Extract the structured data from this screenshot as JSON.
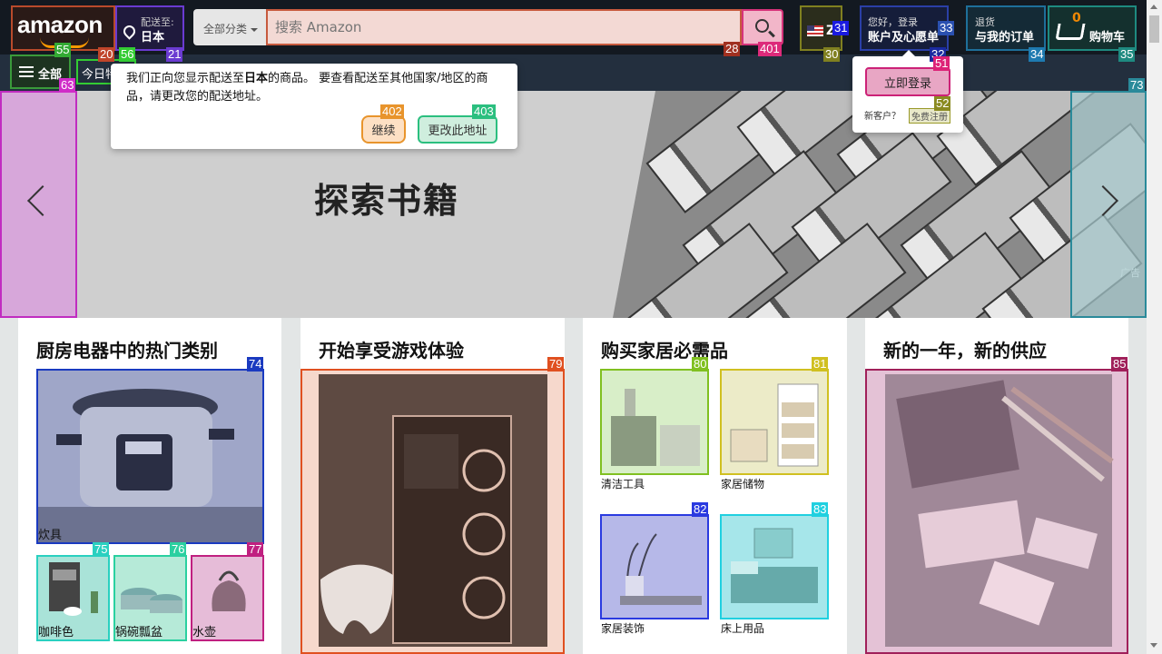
{
  "header": {
    "logo_text": "amazon",
    "deliver_line1": "配送至:",
    "deliver_line2": "日本",
    "search_category": "全部分类",
    "search_placeholder": "搜索 Amazon",
    "language_code": "Z",
    "account_line1": "您好，登录",
    "account_line2": "账户及心愿单",
    "orders_line1": "退货",
    "orders_line2": "与我的订单",
    "cart_count": "0",
    "cart_label": "购物车"
  },
  "subnav": {
    "all_label": "全部",
    "today_deals": "今日特"
  },
  "popup": {
    "message_prefix": "我们正向您显示配送至",
    "message_bold": "日本",
    "message_suffix": "的商品。 要查看配送至其他国家/地区的商品，请更改您的配送地址。",
    "continue_label": "继续",
    "change_label": "更改此地址"
  },
  "signin": {
    "button_label": "立即登录",
    "new_customer": "新客户？",
    "start_here": "免费注册"
  },
  "hero": {
    "title": "探索书籍",
    "ad_label": "广告"
  },
  "cards": [
    {
      "title": "厨房电器中的热门类别",
      "tiles": [
        "炊具",
        "咖啡色",
        "锅碗瓢盆",
        "水壶"
      ]
    },
    {
      "title": "开始享受游戏体验"
    },
    {
      "title": "购买家居必需品",
      "tiles": [
        "清洁工具",
        "家居储物",
        "家居装饰",
        "床上用品"
      ]
    },
    {
      "title": "新的一年，新的供应"
    }
  ],
  "badges": [
    {
      "text": "55",
      "color": "#33aa33"
    },
    {
      "text": "20",
      "color": "#c0452a"
    },
    {
      "text": "56",
      "color": "#33cc33"
    },
    {
      "text": "21",
      "color": "#6a3bd1"
    },
    {
      "text": "28",
      "color": "#a03020"
    },
    {
      "text": "401",
      "color": "#dd2a7a"
    },
    {
      "text": "30",
      "color": "#808020"
    },
    {
      "text": "31",
      "color": "#1a1ae0"
    },
    {
      "text": "33",
      "color": "#2a50b0"
    },
    {
      "text": "32",
      "color": "#1a2aa0"
    },
    {
      "text": "34",
      "color": "#1e7ab0"
    },
    {
      "text": "35",
      "color": "#1e8a80"
    },
    {
      "text": "63",
      "color": "#d02cc8"
    },
    {
      "text": "402",
      "color": "#e8942c"
    },
    {
      "text": "403",
      "color": "#2bbf7f"
    },
    {
      "text": "51",
      "color": "#dd2277"
    },
    {
      "text": "52",
      "color": "#8a8a20"
    },
    {
      "text": "73",
      "color": "#2a8a9a"
    },
    {
      "text": "74",
      "color": "#1a3ac0"
    },
    {
      "text": "75",
      "color": "#2ad0c0"
    },
    {
      "text": "76",
      "color": "#2ad0a0"
    },
    {
      "text": "77",
      "color": "#c02080"
    },
    {
      "text": "79",
      "color": "#e05020"
    },
    {
      "text": "80",
      "color": "#80c020"
    },
    {
      "text": "81",
      "color": "#d0c020"
    },
    {
      "text": "82",
      "color": "#2a3ae0"
    },
    {
      "text": "83",
      "color": "#20d0e0"
    },
    {
      "text": "85",
      "color": "#a0205a"
    }
  ]
}
